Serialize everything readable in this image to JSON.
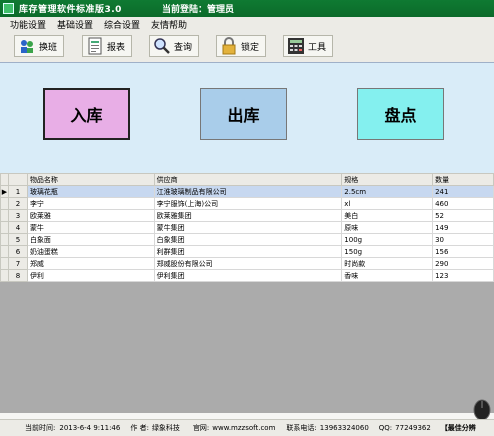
{
  "window": {
    "title": "库存管理软件标准版3.0",
    "login_label": "当前登陆：管理员"
  },
  "menu": [
    "功能设置",
    "基础设置",
    "综合设置",
    "友情帮助"
  ],
  "toolbar": [
    {
      "label": "换班",
      "icon": "people-swap-icon"
    },
    {
      "label": "报表",
      "icon": "report-icon"
    },
    {
      "label": "查询",
      "icon": "magnifier-icon"
    },
    {
      "label": "锁定",
      "icon": "lock-icon"
    },
    {
      "label": "工具",
      "icon": "calculator-icon"
    }
  ],
  "actions": {
    "stock_in": "入库",
    "stock_out": "出库",
    "inventory": "盘点"
  },
  "colors": {
    "stock_in_bg": "#e8aee6",
    "stock_out_bg": "#a9cdea",
    "inventory_bg": "#84f0ef",
    "main_bg": "#d9ecf8",
    "titlebar": "#0f7a32"
  },
  "table": {
    "headers": [
      "物品名称",
      "供应商",
      "规格",
      "数量"
    ],
    "rows": [
      {
        "no": "1",
        "name": "玻璃花瓶",
        "supplier": "江淮玻璃制品有限公司",
        "spec": "2.5cm",
        "qty": "241"
      },
      {
        "no": "2",
        "name": "李宁",
        "supplier": "李宁服饰(上海)公司",
        "spec": "xl",
        "qty": "460"
      },
      {
        "no": "3",
        "name": "欧莱雅",
        "supplier": "欧莱雅集团",
        "spec": "美白",
        "qty": "52"
      },
      {
        "no": "4",
        "name": "蒙牛",
        "supplier": "蒙牛集团",
        "spec": "原味",
        "qty": "149"
      },
      {
        "no": "5",
        "name": "白象面",
        "supplier": "白象集团",
        "spec": "100g",
        "qty": "30"
      },
      {
        "no": "6",
        "name": "奶油蛋糕",
        "supplier": "利群集团",
        "spec": "150g",
        "qty": "156"
      },
      {
        "no": "7",
        "name": "郑威",
        "supplier": "郑威股份有限公司",
        "spec": "时尚款",
        "qty": "290"
      },
      {
        "no": "8",
        "name": "伊利",
        "supplier": "伊利集团",
        "spec": "香味",
        "qty": "123"
      }
    ]
  },
  "status": {
    "time_label": "当前时间:",
    "time_value": "2013-6-4 9:11:46",
    "author_label": "作 者:",
    "author_value": "绿象科技",
    "site_label": "官网:",
    "site_value": "www.mzzsoft.com",
    "phone_label": "联系电话:",
    "phone_value": "13963324060",
    "qq_label": "QQ:",
    "qq_value": "77249362",
    "slogan": "【最佳分辨"
  }
}
